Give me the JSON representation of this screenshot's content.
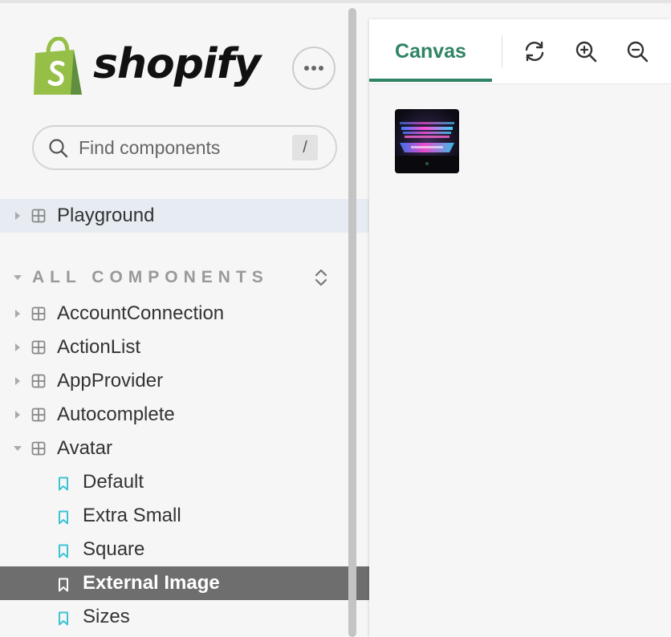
{
  "brand": {
    "name": "shopify",
    "logo_color": "#95bf47"
  },
  "sidebar": {
    "more_button_label": "More options",
    "search": {
      "placeholder": "Find components",
      "value": "",
      "shortcut": "/"
    },
    "playground": {
      "label": "Playground"
    },
    "section": {
      "title": "ALL COMPONENTS"
    },
    "components": [
      {
        "label": "AccountConnection",
        "expanded": false
      },
      {
        "label": "ActionList",
        "expanded": false
      },
      {
        "label": "AppProvider",
        "expanded": false
      },
      {
        "label": "Autocomplete",
        "expanded": false
      },
      {
        "label": "Avatar",
        "expanded": true
      }
    ],
    "stories": [
      {
        "label": "Default",
        "selected": false
      },
      {
        "label": "Extra Small",
        "selected": false
      },
      {
        "label": "Square",
        "selected": false
      },
      {
        "label": "External Image",
        "selected": true
      },
      {
        "label": "Sizes",
        "selected": false
      }
    ]
  },
  "panel": {
    "tabs": [
      {
        "label": "Canvas",
        "active": true
      }
    ],
    "tools": [
      {
        "name": "reload-icon"
      },
      {
        "name": "zoom-in-icon"
      },
      {
        "name": "zoom-out-icon"
      }
    ],
    "canvas": {
      "preview": "avatar-external-image"
    }
  },
  "colors": {
    "accent": "#2f8463",
    "selected_bg": "#6e6e6e",
    "highlight_bg": "#e6ecf2",
    "story_icon": "#3ec3d4"
  }
}
